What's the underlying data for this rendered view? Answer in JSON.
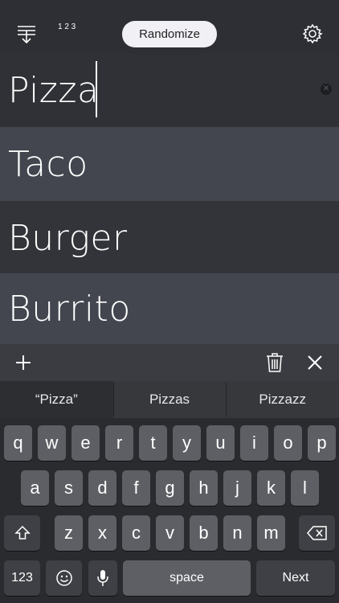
{
  "toolbar": {
    "sort_icon": "sort-down-icon",
    "number_order_label": "1 2 3",
    "randomize_label": "Randomize",
    "settings_icon": "gear-icon"
  },
  "items": [
    {
      "label": "Pizza",
      "editing": true
    },
    {
      "label": "Taco"
    },
    {
      "label": "Burger"
    },
    {
      "label": "Burrito"
    }
  ],
  "clear_icon": "clear-icon",
  "edit_bar": {
    "add_icon": "plus-icon",
    "delete_icon": "trash-icon",
    "close_icon": "close-icon"
  },
  "suggestions": [
    "“Pizza”",
    "Pizzas",
    "Pizzazz"
  ],
  "keyboard": {
    "row1": [
      "q",
      "w",
      "e",
      "r",
      "t",
      "y",
      "u",
      "i",
      "o",
      "p"
    ],
    "row2": [
      "a",
      "s",
      "d",
      "f",
      "g",
      "h",
      "j",
      "k",
      "l"
    ],
    "row3": [
      "z",
      "x",
      "c",
      "v",
      "b",
      "n",
      "m"
    ],
    "numbers_label": "123",
    "space_label": "space",
    "next_label": "Next"
  }
}
